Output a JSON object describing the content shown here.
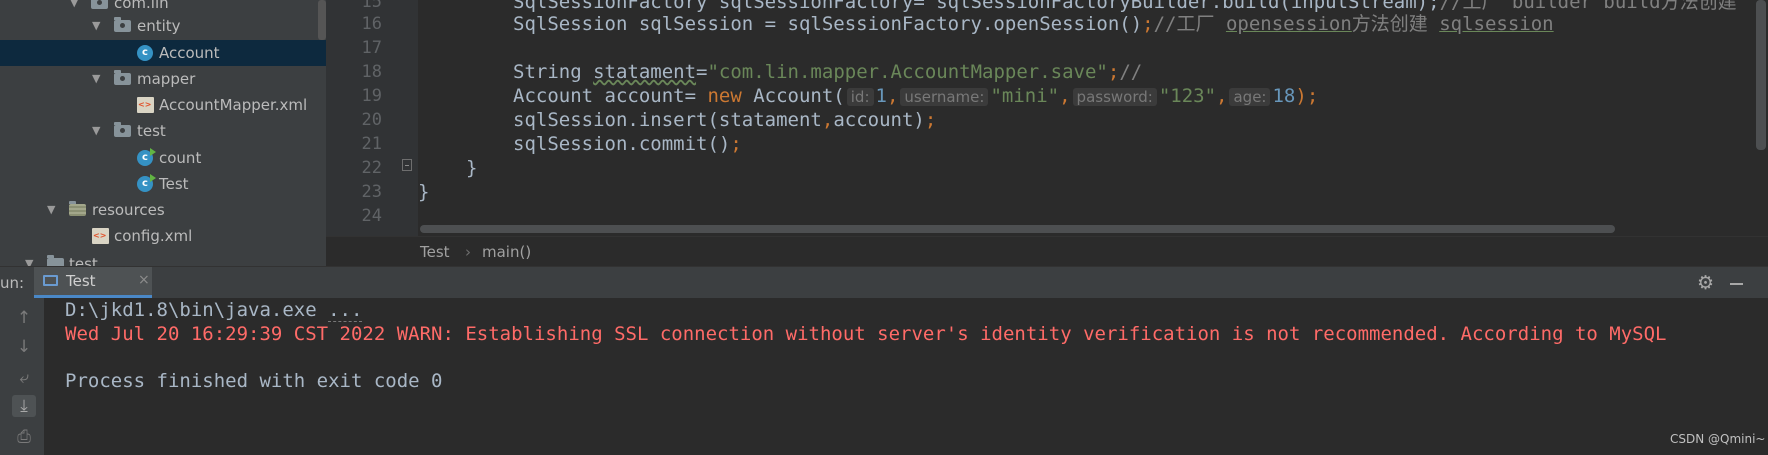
{
  "tree": {
    "items": [
      {
        "label": "com.lin",
        "type": "package",
        "expanded": true
      },
      {
        "label": "entity",
        "type": "package",
        "expanded": true
      },
      {
        "label": "Account",
        "type": "class",
        "selected": true
      },
      {
        "label": "mapper",
        "type": "package",
        "expanded": true
      },
      {
        "label": "AccountMapper.xml",
        "type": "xml"
      },
      {
        "label": "test",
        "type": "package",
        "expanded": true
      },
      {
        "label": "count",
        "type": "runnable-class"
      },
      {
        "label": "Test",
        "type": "runnable-class"
      },
      {
        "label": "resources",
        "type": "resources-folder",
        "expanded": true
      },
      {
        "label": "config.xml",
        "type": "xml"
      },
      {
        "label": "test",
        "type": "folder",
        "expanded": true
      }
    ]
  },
  "editor": {
    "line_numbers": [
      "15",
      "16",
      "17",
      "18",
      "19",
      "20",
      "21",
      "22",
      "23",
      "24"
    ],
    "line15": {
      "text": "SqlSessionFactory sqlSessionFactory= sqlSessionFactoryBuilder.build(inputStream);",
      "comment": "//工厂 builder build方法创建"
    },
    "line16": {
      "a": "SqlSession sqlSession = sqlSessionFactory.openSession()",
      "b": ";",
      "c": "//工厂 ",
      "d": "opensession",
      "e": "方法创建 ",
      "f": "sqlsession"
    },
    "line18": {
      "a": "String ",
      "b": "statament",
      "c": "=",
      "d": "\"com.lin.mapper.AccountMapper.save\"",
      "e": ";",
      "f": "//"
    },
    "line19": {
      "a": "Account account= ",
      "kw_new": "new",
      "b": " Account(",
      "hint1": "id:",
      "v1": "1",
      "comma": ",",
      "hint2": "username:",
      "v2": "\"mini\"",
      "hint3": "password:",
      "v3": "\"123\"",
      "hint4": "age:",
      "v4": "18",
      "end": ");"
    },
    "line20": {
      "a": "sqlSession.insert(statament",
      "b": ",",
      "c": "account)",
      "d": ";"
    },
    "line21": {
      "a": "sqlSession.commit()",
      "b": ";"
    },
    "line22": "}",
    "line23": "}"
  },
  "breadcrumb": {
    "class": "Test",
    "separator": "›",
    "method": "main()"
  },
  "run": {
    "label": "un:",
    "tab_label": "Test",
    "tab_close": "×",
    "console": {
      "line1_cmd": "D:\\jkd1.8\\bin\\java.exe ",
      "line1_ellipsis": "...",
      "line2": "Wed Jul 20 16:29:39 CST 2022 WARN: Establishing SSL connection without server's identity verification is not recommended. According to MySQL",
      "line3": "Process finished with exit code 0"
    }
  },
  "watermark": "CSDN @Qmini~",
  "colors": {
    "keyword": "#cc7832",
    "string": "#6a8759",
    "number": "#6897bb",
    "error": "#ff6b68",
    "selection": "#0d293e"
  }
}
